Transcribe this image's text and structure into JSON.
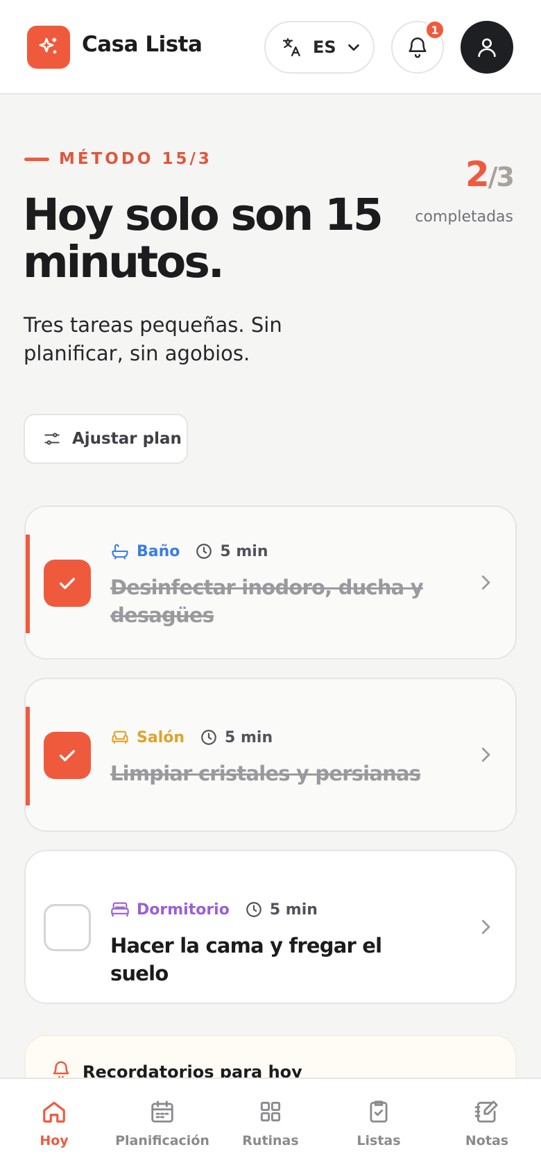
{
  "header": {
    "app_title": "Casa Lista",
    "logo_icon": "sparkles-icon",
    "language": "ES",
    "notification_count": "1",
    "colors": {
      "brand": "#f05a3c",
      "avatar_bg": "#1e1f22"
    }
  },
  "hero": {
    "eyebrow": "MÉTODO 15/3",
    "headline": "Hoy solo son 15 minutos.",
    "subtitle": "Tres tareas pequeñas. Sin planificar, sin agobios.",
    "completed": "2",
    "total": "/3",
    "completed_label": "completadas",
    "adjust_label": "Ajustar plan"
  },
  "tasks": [
    {
      "category": "Baño",
      "category_icon": "bathtub-icon",
      "category_color": "#3b7fe0",
      "duration": "5 min",
      "title": "Desinfectar inodoro, ducha y desagües",
      "done": true
    },
    {
      "category": "Salón",
      "category_icon": "sofa-icon",
      "category_color": "#e0a32a",
      "duration": "5 min",
      "title": "Limpiar cristales y persianas",
      "done": true
    },
    {
      "category": "Dormitorio",
      "category_icon": "bed-icon",
      "category_color": "#9b5fd6",
      "duration": "5 min",
      "title": "Hacer la cama y fregar el suelo",
      "done": false
    }
  ],
  "reminders": {
    "title": "Recordatorios para hoy"
  },
  "nav": [
    {
      "label": "Hoy",
      "icon": "home-icon",
      "active": true
    },
    {
      "label": "Planificación",
      "icon": "calendar-icon",
      "active": false
    },
    {
      "label": "Rutinas",
      "icon": "grid-icon",
      "active": false
    },
    {
      "label": "Listas",
      "icon": "clipboard-check-icon",
      "active": false
    },
    {
      "label": "Notas",
      "icon": "note-edit-icon",
      "active": false
    }
  ]
}
